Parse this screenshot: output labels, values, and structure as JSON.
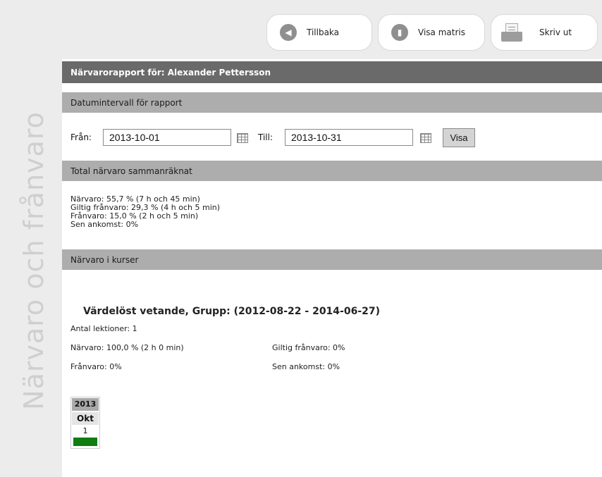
{
  "sidebar": {
    "title": "Närvaro och frånvaro"
  },
  "toolbar": {
    "back_label": "Tillbaka",
    "matrix_label": "Visa matris",
    "print_label": "Skriv ut"
  },
  "report": {
    "header": "Närvarorapport för: Alexander Pettersson",
    "date_section": {
      "title": "Datumintervall för rapport",
      "from_label": "Från:",
      "from_value": "2013-10-01",
      "to_label": "Till:",
      "to_value": "2013-10-31",
      "show_button": "Visa"
    },
    "total_section": {
      "title": "Total närvaro sammanräknat",
      "lines": [
        "Närvaro: 55,7 % (7 h och 45 min)",
        "Giltig frånvaro: 29,3 % (4 h och 5 min)",
        "Frånvaro: 15,0 % (2 h och 5 min)",
        "Sen ankomst: 0%"
      ]
    },
    "courses_section": {
      "title": "Närvaro i kurser",
      "courses": [
        {
          "title": "Värdelöst vetande, Grupp: (2012-08-22 - 2014-06-27)",
          "lessons": "Antal lektioner: 1",
          "attendance": "Närvaro: 100,0 % (2 h 0 min)",
          "valid_absence": "Giltig frånvaro: 0%",
          "absence": "Frånvaro: 0%",
          "late": "Sen ankomst: 0%",
          "calendar": {
            "year": "2013",
            "month": "Okt",
            "day": "1",
            "status_color": "#0f7d0f"
          }
        }
      ]
    }
  }
}
